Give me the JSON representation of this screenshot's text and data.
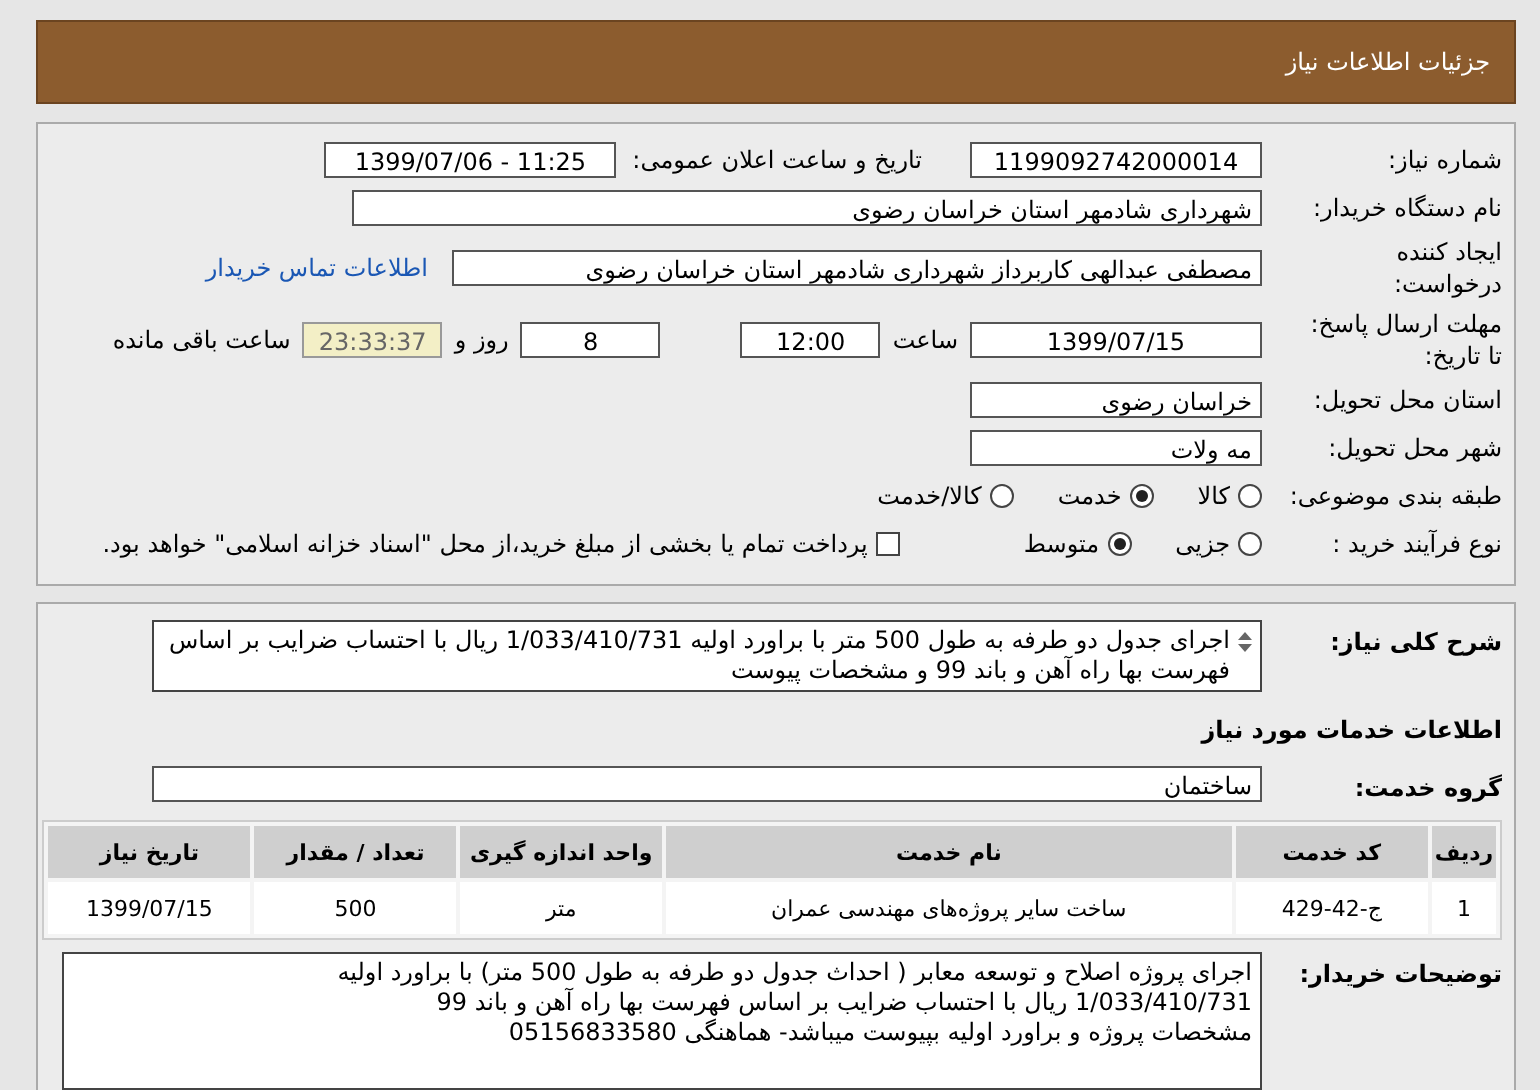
{
  "header": {
    "title": "جزئیات اطلاعات نیاز"
  },
  "need_number": {
    "label": "شماره نیاز:",
    "value": "1199092742000014"
  },
  "announce": {
    "label": "تاریخ و ساعت اعلان عمومی:",
    "value": "1399/07/06 - 11:25"
  },
  "buyer_org": {
    "label": "نام دستگاه خریدار:",
    "value": "شهرداری شادمهر استان خراسان رضوی"
  },
  "requester": {
    "label_lines": [
      "ایجاد کننده",
      "درخواست:"
    ],
    "value": "مصطفی عبدالهی کاربرداز شهرداری شادمهر استان خراسان رضوی",
    "contact_link": "اطلاعات تماس خریدار"
  },
  "deadline": {
    "label_lines": [
      "مهلت ارسال پاسخ:",
      "تا تاریخ:"
    ],
    "date": "1399/07/15",
    "time_label": "ساعت",
    "time": "12:00",
    "days": "8",
    "days_label": "روز و",
    "remaining": "23:33:37",
    "remaining_label": "ساعت باقی مانده"
  },
  "province": {
    "label": "استان محل تحویل:",
    "value": "خراسان رضوی"
  },
  "city": {
    "label": "شهر محل تحویل:",
    "value": "مه ولات"
  },
  "category": {
    "label": "طبقه بندی موضوعی:",
    "options": [
      {
        "label": "کالا",
        "selected": false
      },
      {
        "label": "خدمت",
        "selected": true
      },
      {
        "label": "کالا/خدمت",
        "selected": false
      }
    ]
  },
  "purchase_process": {
    "label": "نوع فرآیند خرید :",
    "options": [
      {
        "label": "جزیی",
        "selected": false
      },
      {
        "label": "متوسط",
        "selected": true
      }
    ],
    "payment_note": {
      "label": "پرداخت تمام یا بخشی از مبلغ خرید،از محل \"اسناد خزانه اسلامی\" خواهد بود.",
      "checked": false
    }
  },
  "description": {
    "label": "شرح کلی نیاز:",
    "text": "اجرای جدول دو طرفه به طول 500 متر با براورد اولیه  1/033/410/731 ریال با احتساب ضرایب بر اساس فهرست بها راه آهن و باند 99 و مشخصات پیوست"
  },
  "services_title": "اطلاعات خدمات مورد نیاز",
  "service_group": {
    "label": "گروه خدمت:",
    "value": "ساختمان"
  },
  "table": {
    "columns": [
      "ردیف",
      "کد خدمت",
      "نام خدمت",
      "واحد اندازه گیری",
      "تعداد / مقدار",
      "تاریخ نیاز"
    ],
    "rows": [
      [
        "1",
        "ج-42-429",
        "ساخت سایر پروژه‌های مهندسی عمران",
        "متر",
        "500",
        "1399/07/15"
      ]
    ]
  },
  "buyer_notes": {
    "label": "توضیحات خریدار:",
    "lines": [
      "اجرای پروژه اصلاح و توسعه معابر ( احداث جدول دو طرفه به طول 500 متر)  با براورد اولیه",
      "1/033/410/731 ریال با احتساب ضرایب بر اساس فهرست بها راه آهن و باند 99",
      "مشخصات پروژه و براورد اولیه بپیوست میباشد- هماهنگی 05156833580"
    ]
  }
}
